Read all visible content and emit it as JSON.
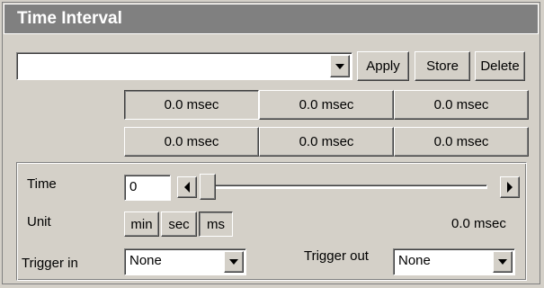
{
  "window": {
    "title": "Time Interval"
  },
  "toolbar": {
    "preset_value": "",
    "apply_label": "Apply",
    "store_label": "Store",
    "delete_label": "Delete"
  },
  "interval_grid": {
    "row1": [
      "0.0 msec",
      "0.0 msec",
      "0.0 msec"
    ],
    "row2": [
      "0.0 msec",
      "0.0 msec",
      "0.0 msec"
    ]
  },
  "controls": {
    "time_label": "Time",
    "time_value": "0",
    "unit_label": "Unit",
    "unit_options": [
      "min",
      "sec",
      "ms"
    ],
    "unit_selected": "ms",
    "readout": "0.0 msec",
    "slider_level": 0,
    "trigger_in_label": "Trigger in",
    "trigger_in_value": "None",
    "trigger_out_label": "Trigger out",
    "trigger_out_value": "None"
  }
}
